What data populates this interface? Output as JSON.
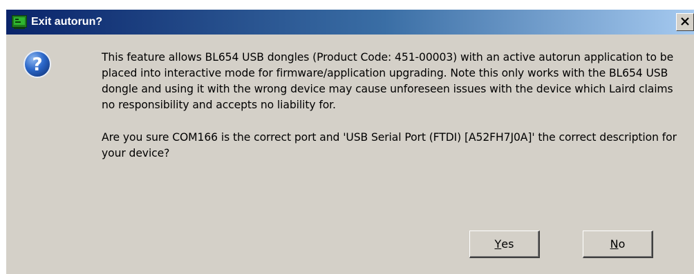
{
  "window": {
    "title": "Exit autorun?",
    "close_glyph": "X"
  },
  "icons": {
    "app": "app-window-icon",
    "question": "question-icon",
    "close": "close-icon"
  },
  "message": {
    "paragraph1": "This feature allows BL654 USB dongles (Product Code: 451-00003) with an active autorun application to be placed into interactive mode for firmware/application upgrading. Note this only works with the BL654 USB dongle and using it with the wrong device may cause unforeseen issues with the device which Laird claims no responsibility and accepts no liability for.",
    "paragraph2": "Are you sure COM166 is the correct port and 'USB Serial Port (FTDI) [A52FH7J0A]' the correct description for your device?"
  },
  "buttons": {
    "yes_mnemonic": "Y",
    "yes_rest": "es",
    "no_mnemonic": "N",
    "no_rest": "o"
  },
  "colors": {
    "title_start": "#0a246a",
    "title_end": "#a6caf0",
    "dialog_face": "#d4d0c8",
    "question_blue": "#2a66c8"
  }
}
